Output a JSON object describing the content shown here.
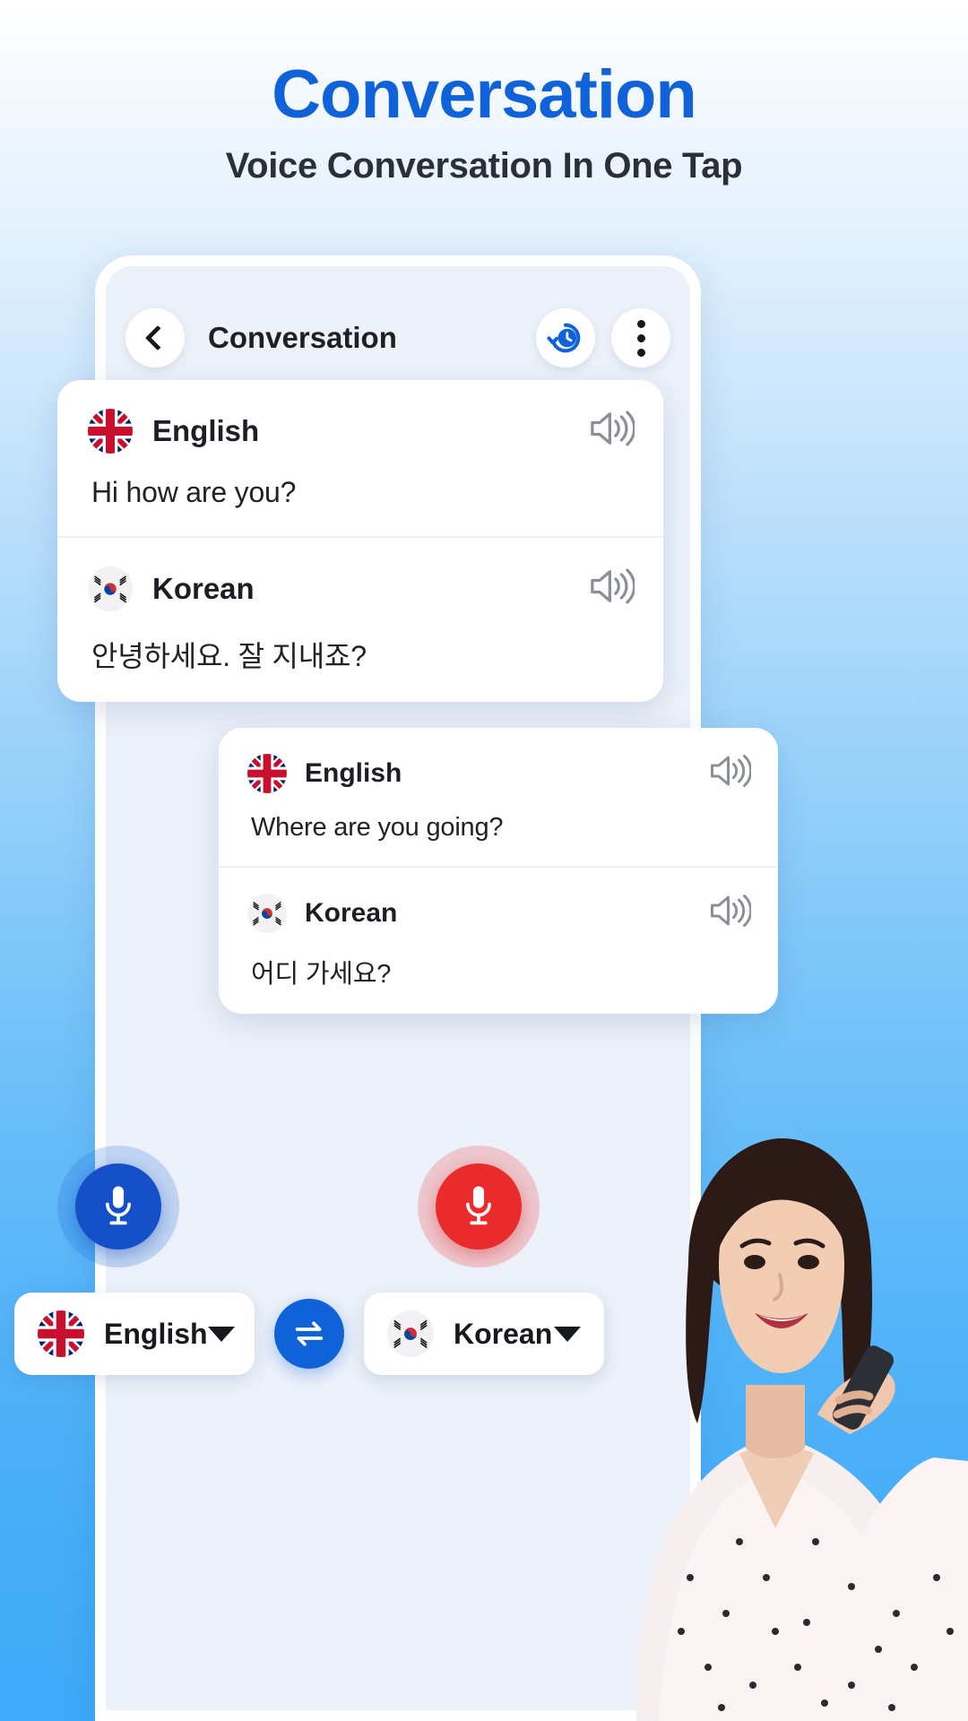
{
  "promo": {
    "title": "Conversation",
    "subtitle": "Voice Conversation In One Tap",
    "title_color": "#0f62d8",
    "subtitle_color": "#2b2f36",
    "background_top": "#ffffff",
    "background_bottom": "#3ea9f8"
  },
  "phone": {
    "header": {
      "back_icon": "chevron-left-icon",
      "title": "Conversation",
      "history_icon": "history-clock-icon",
      "history_color": "#0f62d8",
      "menu_icon": "more-vertical-icon"
    },
    "cards": [
      {
        "rows": [
          {
            "flag": "uk-flag-icon",
            "language": "English",
            "text": "Hi how are you?",
            "speaker_icon": "speaker-icon"
          },
          {
            "flag": "korea-flag-icon",
            "language": "Korean",
            "text": "안녕하세요. 잘 지내죠?",
            "speaker_icon": "speaker-icon"
          }
        ]
      },
      {
        "rows": [
          {
            "flag": "uk-flag-icon",
            "language": "English",
            "text": "Where are you going?",
            "speaker_icon": "speaker-icon"
          },
          {
            "flag": "korea-flag-icon",
            "language": "Korean",
            "text": "어디 가세요?",
            "speaker_icon": "speaker-icon"
          }
        ]
      }
    ],
    "mics": {
      "left": {
        "icon": "microphone-icon",
        "color": "#1550c8",
        "glow": "#1f6edc"
      },
      "right": {
        "icon": "microphone-icon",
        "color": "#ea2b2b",
        "glow": "#ec3030"
      }
    },
    "bottom_bar": {
      "source_language": "English",
      "source_flag": "uk-flag-icon",
      "target_language": "Korean",
      "target_flag": "korea-flag-icon",
      "swap_icon": "swap-horizontal-icon",
      "swap_color": "#0f62d8",
      "dropdown_icon": "caret-down-icon"
    }
  }
}
